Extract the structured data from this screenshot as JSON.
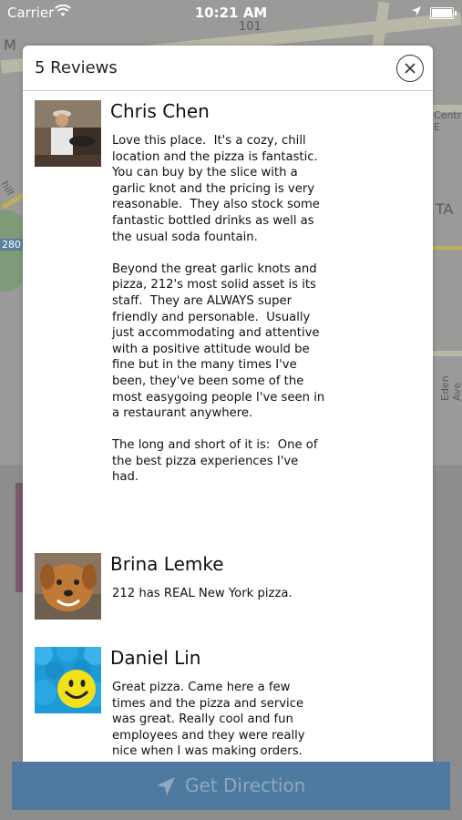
{
  "status_bar": {
    "carrier": "Carrier",
    "time": "10:21 AM"
  },
  "map_labels": [
    "101",
    "Central E",
    "TA",
    "Eden Ave",
    "280",
    "hill",
    "M"
  ],
  "modal": {
    "title": "5 Reviews",
    "close_icon": "close-circle-icon"
  },
  "reviews": [
    {
      "name": "Chris Chen",
      "avatar": "photo-man-grilling",
      "text": "Love this place.  It's a cozy, chill location and the pizza is fantastic. You can buy by the slice with a garlic knot and the pricing is very reasonable.  They also stock some fantastic bottled drinks as well as the usual soda fountain.\n\nBeyond the great garlic knots and pizza, 212's most solid asset is its staff.  They are ALWAYS super friendly and personable.  Usually just accommodating and attentive with a positive attitude would be fine but in the many times I've been, they've been some of the most easygoing people I've seen in a restaurant anywhere.\n\nThe long and short of it is:  One of the best pizza experiences I've had."
    },
    {
      "name": "Brina Lemke",
      "avatar": "photo-dog",
      "text": "212 has REAL New York pizza."
    },
    {
      "name": "Daniel Lin",
      "avatar": "photo-smiley-balls",
      "text": "Great pizza. Came here a few times and the pizza and service was great. Really cool and fun employees and they were really nice when I was making orders.\nPizza is kinda expensive, but..."
    }
  ],
  "footer": {
    "button_label": "Get Direction",
    "button_icon": "location-arrow-icon",
    "color": "#4d7a9e"
  }
}
